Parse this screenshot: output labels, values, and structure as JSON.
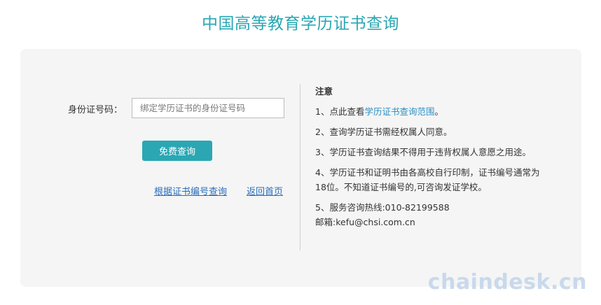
{
  "title": "中国高等教育学历证书查询",
  "form": {
    "id_label": "身份证号码：",
    "id_placeholder": "绑定学历证书的身份证号码",
    "id_value": "",
    "submit_label": "免费查询",
    "link_by_cert": "根据证书编号查询",
    "link_home": "返回首页"
  },
  "notes": {
    "title": "注意",
    "n1_prefix": "1、点此查看",
    "n1_link": "学历证书查询范围",
    "n1_suffix": "。",
    "n2": "2、查询学历证书需经权属人同意。",
    "n3": "3、学历证书查询结果不得用于违背权属人意愿之用途。",
    "n4": "4、学历证书和证明书由各高校自行印制，证书编号通常为18位。不知道证书编号的,可咨询发证学校。",
    "n5_hotline": "5、服务咨询热线:010-82199588",
    "n5_email": "邮箱:kefu@chsi.com.cn"
  },
  "watermark": "chaindesk.cn",
  "colors": {
    "accent": "#2aa7b3",
    "link": "#2a6ebb",
    "panel": "#f5f5f5"
  }
}
